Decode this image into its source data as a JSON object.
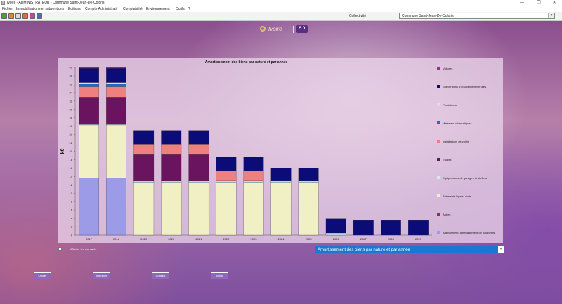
{
  "window": {
    "title": "Ivoire - ADMINISTRATEUR - Commune Saint-Jean-De-Coloris",
    "minimize": "—",
    "maximize": "❐",
    "close": "✕"
  },
  "menu": [
    "Fichier",
    "Immobilisations et subventions",
    "Editions",
    "Compte Administratif",
    "Comptabilité",
    "Environnement",
    "Outils",
    "?"
  ],
  "toolbar": {
    "icons": [
      "app-icon",
      "save-icon",
      "print-icon",
      "export-icon",
      "chart-icon",
      "disk-icon"
    ]
  },
  "collectivite": {
    "label": "Collectivité",
    "value": "Commune Saint-Jean-De-Coloris"
  },
  "logo": {
    "brand": "Ivoire",
    "version": "5.0"
  },
  "chart_data": {
    "type": "bar",
    "title": "Amortissement des biens par nature et par année",
    "ylabel": "k€",
    "ylim": [
      0,
      40
    ],
    "yticks": [
      0,
      2,
      4,
      6,
      8,
      10,
      12,
      14,
      16,
      18,
      20,
      22,
      24,
      26,
      28,
      30,
      32,
      34,
      36,
      38,
      40
    ],
    "grid": false,
    "legend_position": "right",
    "categories": [
      "2017",
      "2018",
      "2019",
      "2020",
      "2021",
      "2022",
      "2023",
      "2024",
      "2025",
      "2026",
      "2027",
      "2028",
      "2029"
    ],
    "series": [
      {
        "name": "Agencement, aménagement de bâtiments",
        "color": "#9b9be8",
        "values": [
          13.6,
          13.6,
          0,
          0,
          0,
          0,
          0,
          0,
          0,
          0,
          0,
          0,
          0
        ]
      },
      {
        "name": "Autres",
        "color": "#8a2f55",
        "values": [
          0,
          0,
          0,
          0,
          0,
          0,
          0,
          0,
          0,
          0,
          0,
          0,
          0
        ]
      },
      {
        "name": "Bâtiments légers, abris",
        "color": "#f0f0c4",
        "values": [
          12.5,
          12.5,
          12.6,
          12.6,
          12.6,
          12.6,
          12.6,
          12.6,
          12.6,
          0,
          0,
          0,
          0
        ]
      },
      {
        "name": "Equipements de garages et ateliers",
        "color": "#c7eff5",
        "values": [
          0.3,
          0.3,
          0.3,
          0.3,
          0.3,
          0.3,
          0.3,
          0.3,
          0.3,
          0.5,
          0,
          0,
          0
        ]
      },
      {
        "name": "Etudes",
        "color": "#6a1460",
        "values": [
          6.5,
          6.5,
          6.3,
          6.3,
          6.3,
          0,
          0,
          0,
          0,
          0,
          0,
          0,
          0
        ]
      },
      {
        "name": "Installations de voirie",
        "color": "#ef8080",
        "values": [
          2.5,
          2.5,
          2.5,
          2.5,
          2.5,
          2.5,
          2.5,
          0,
          0,
          0,
          0,
          0,
          0
        ]
      },
      {
        "name": "Matériels informatiques",
        "color": "#1a6fcc",
        "values": [
          0.6,
          0.6,
          0,
          0,
          0,
          0,
          0,
          0,
          0,
          0,
          0,
          0,
          0
        ]
      },
      {
        "name": "Plantations",
        "color": "#e8d6ea",
        "values": [
          0.4,
          0.4,
          0,
          0,
          0,
          0,
          0,
          0,
          0,
          0,
          0,
          0,
          0
        ]
      },
      {
        "name": "Subventions d'équipement versées",
        "color": "#0c0c78",
        "values": [
          3.4,
          3.4,
          3.3,
          3.3,
          3.3,
          3.2,
          3.2,
          3.1,
          3.1,
          3.4,
          3.5,
          3.5,
          3.5
        ]
      },
      {
        "name": "Voitures",
        "color": "#e000c0",
        "values": [
          0.2,
          0.2,
          0,
          0,
          0,
          0,
          0,
          0,
          0,
          0,
          0,
          0,
          0
        ]
      }
    ]
  },
  "options": {
    "show_amounts_label": "Afficher les montants"
  },
  "view_select": {
    "value": "Amortissement des biens par nature et par année"
  },
  "footer_buttons": [
    {
      "name": "quit-button",
      "label": "Quitter"
    },
    {
      "name": "print-button",
      "label": "Imprimer"
    },
    {
      "name": "contact-button",
      "label": "Contact"
    },
    {
      "name": "info-button",
      "label": "Infos"
    }
  ]
}
